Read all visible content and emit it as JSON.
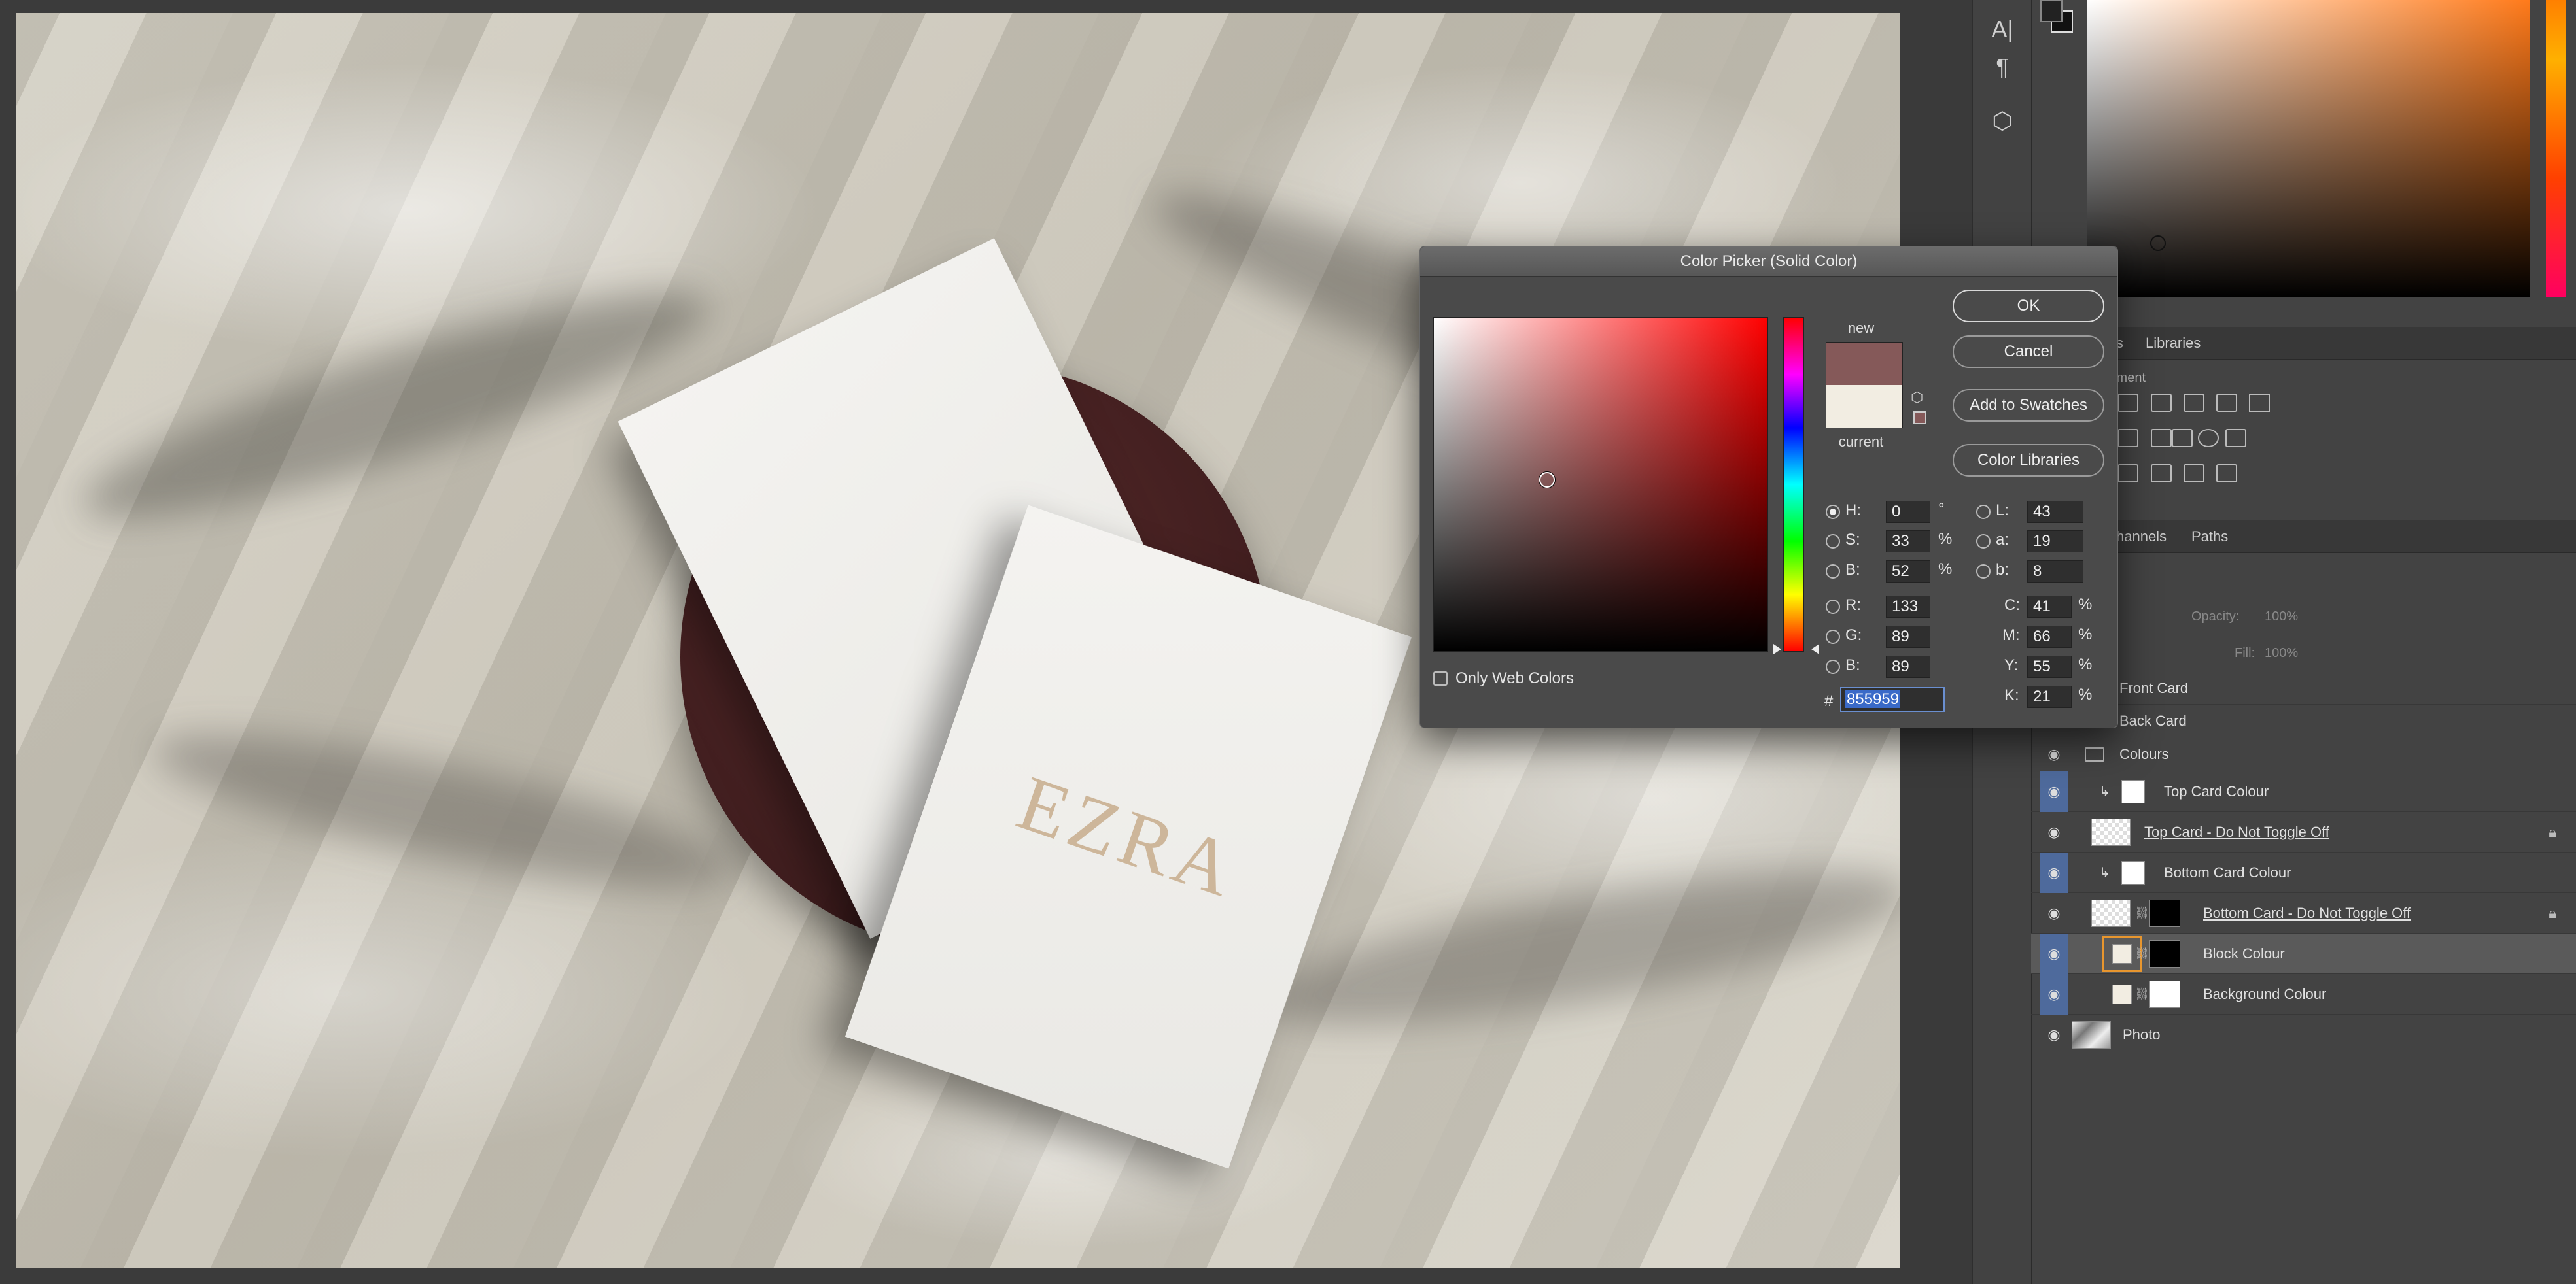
{
  "canvas": {
    "card_text": "EZRA"
  },
  "tools": [
    "text-vertical-icon",
    "paragraph-icon",
    "3d-cube-icon"
  ],
  "panel_tabs_adjust": {
    "tab1": "s",
    "tab2": "Libraries",
    "section": "tment"
  },
  "panel_tabs_layers": {
    "tab1": "hannels",
    "tab2": "Paths"
  },
  "layer_controls": {
    "opacity_label": "Opacity:",
    "opacity_value": "100%",
    "fill_label": "Fill:",
    "fill_value": "100%"
  },
  "layers": [
    {
      "name": "Front Card"
    },
    {
      "name": "Back Card"
    },
    {
      "name": "Colours"
    },
    {
      "name": "Top Card Colour"
    },
    {
      "name": "Top Card - Do Not Toggle Off"
    },
    {
      "name": "Bottom Card Colour"
    },
    {
      "name": "Bottom Card - Do Not Toggle Off"
    },
    {
      "name": "Block Colour"
    },
    {
      "name": "Background Colour"
    },
    {
      "name": "Photo"
    }
  ],
  "dialog": {
    "title": "Color Picker (Solid Color)",
    "new_label": "new",
    "current_label": "current",
    "buttons": {
      "ok": "OK",
      "cancel": "Cancel",
      "add": "Add to Swatches",
      "libraries": "Color Libraries"
    },
    "only_web_colors": "Only Web Colors",
    "fields": {
      "H": "0",
      "S": "33",
      "B": "52",
      "R": "133",
      "G": "89",
      "B2": "89",
      "L": "43",
      "a": "19",
      "b": "8",
      "C": "41",
      "M": "66",
      "Y": "55",
      "K": "21"
    },
    "units": {
      "deg": "°",
      "pct": "%"
    },
    "labels": {
      "H": "H:",
      "S": "S:",
      "B": "B:",
      "R": "R:",
      "G": "G:",
      "B2": "B:",
      "L": "L:",
      "a": "a:",
      "b": "b:",
      "C": "C:",
      "M": "M:",
      "Y": "Y:",
      "K": "K:",
      "hash": "#"
    },
    "hex": "855959",
    "new_color": "#855959",
    "current_color": "#f2ede2"
  }
}
